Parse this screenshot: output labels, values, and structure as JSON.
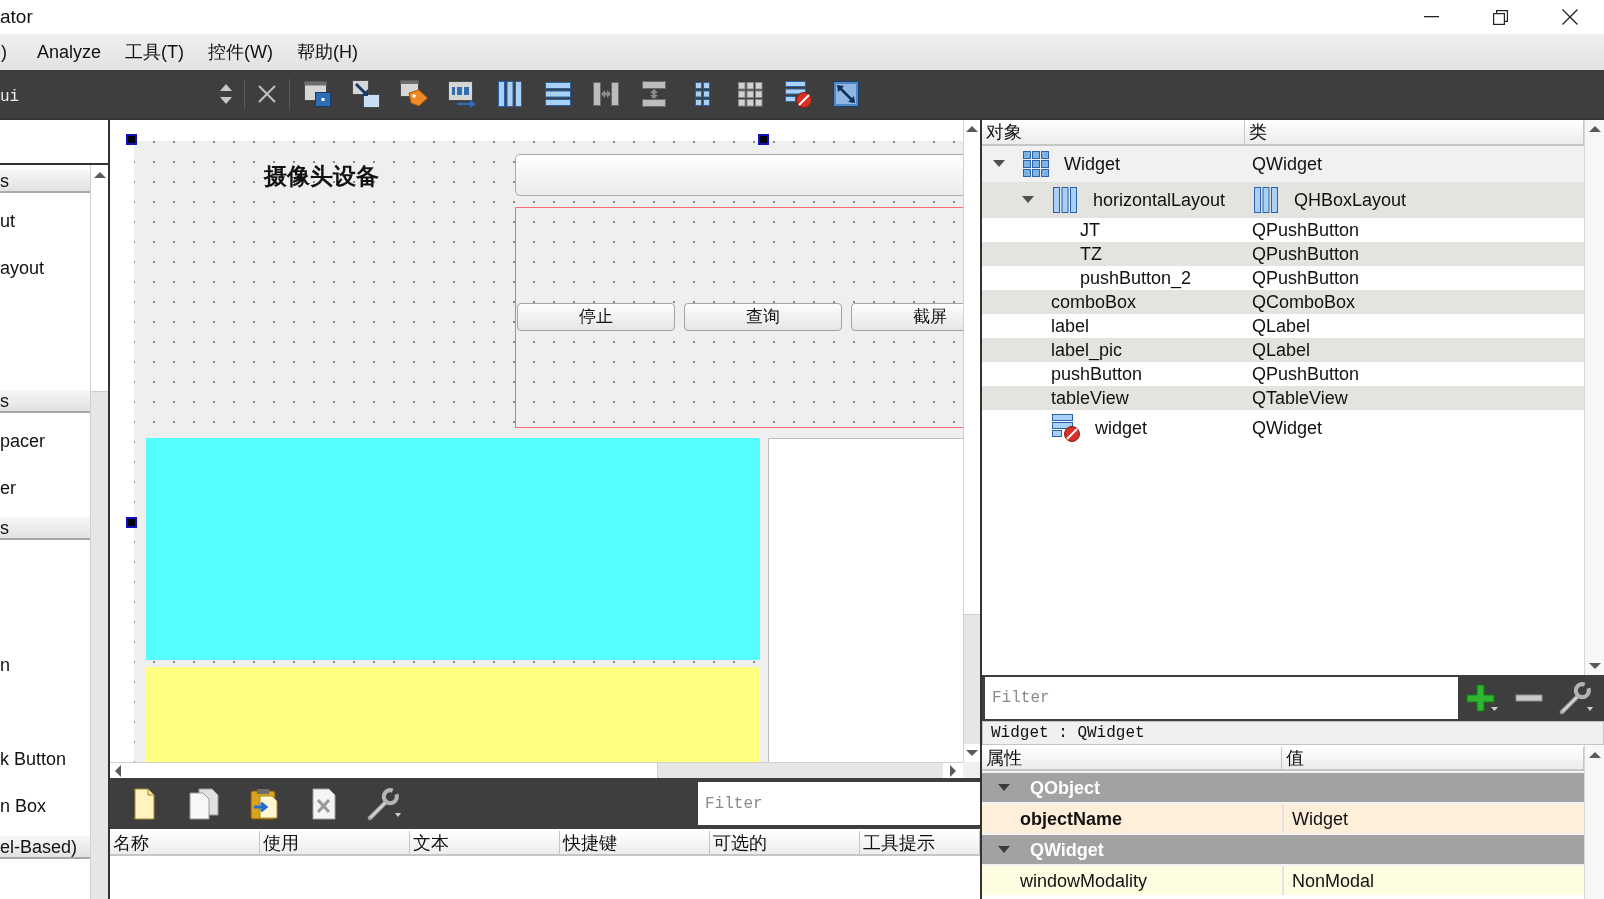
{
  "window": {
    "title": "ator"
  },
  "menu": [
    {
      "label": ")"
    },
    {
      "label": "Analyze"
    },
    {
      "label": "工具(T)"
    },
    {
      "label": "控件(W)"
    },
    {
      "label": "帮助(H)"
    }
  ],
  "toolbar": {
    "label": "ui"
  },
  "widget_box": {
    "categories": [
      {
        "title": "s",
        "items": [
          "ut",
          "ayout"
        ]
      },
      {
        "title": "s",
        "items": [
          "pacer",
          "er"
        ]
      },
      {
        "title": "s",
        "items": [
          "n",
          "k Button",
          "n Box"
        ]
      },
      {
        "title": "el-Based)"
      }
    ]
  },
  "form": {
    "title_label": "摄像头设备",
    "buttons": [
      "停止",
      "查询",
      "截屏"
    ]
  },
  "action_editor": {
    "filter": {
      "placeholder": "Filter"
    },
    "columns": [
      "名称",
      "使用",
      "文本",
      "快捷键",
      "可选的",
      "工具提示"
    ]
  },
  "object_inspector": {
    "columns": [
      "对象",
      "类"
    ],
    "items": [
      {
        "name": "Widget",
        "class": "QWidget",
        "kind": "form",
        "selected": true,
        "expanded": true,
        "children": [
          {
            "name": "horizontalLayout",
            "class": "QHBoxLayout",
            "kind": "layout",
            "selected": false,
            "expanded": true,
            "children": [
              {
                "name": "JT",
                "class": "QPushButton",
                "kind": "widget",
                "selected": false
              },
              {
                "name": "TZ",
                "class": "QPushButton",
                "kind": "widget",
                "selected": false
              },
              {
                "name": "pushButton_2",
                "class": "QPushButton",
                "kind": "widget",
                "selected": false
              }
            ]
          },
          {
            "name": "comboBox",
            "class": "QComboBox",
            "kind": "widget",
            "selected": false
          },
          {
            "name": "label",
            "class": "QLabel",
            "kind": "widget",
            "selected": false
          },
          {
            "name": "label_pic",
            "class": "QLabel",
            "kind": "widget",
            "selected": false
          },
          {
            "name": "pushButton",
            "class": "QPushButton",
            "kind": "widget",
            "selected": false
          },
          {
            "name": "tableView",
            "class": "QTableView",
            "kind": "widget",
            "selected": false
          },
          {
            "name": "widget",
            "class": "QWidget",
            "kind": "container",
            "selected": false
          }
        ]
      }
    ]
  },
  "property_editor": {
    "filter": {
      "placeholder": "Filter"
    },
    "object_label": "Widget : QWidget",
    "columns": [
      "属性",
      "值"
    ],
    "groups": [
      {
        "name": "QObject",
        "expanded": true,
        "color": "#fdefd9",
        "properties": [
          {
            "name": "objectName",
            "value": "Widget",
            "modified": true
          }
        ]
      },
      {
        "name": "QWidget",
        "expanded": true,
        "color": "#fffde1",
        "properties": [
          {
            "name": "windowModality",
            "value": "NonModal",
            "modified": false
          }
        ]
      }
    ]
  }
}
